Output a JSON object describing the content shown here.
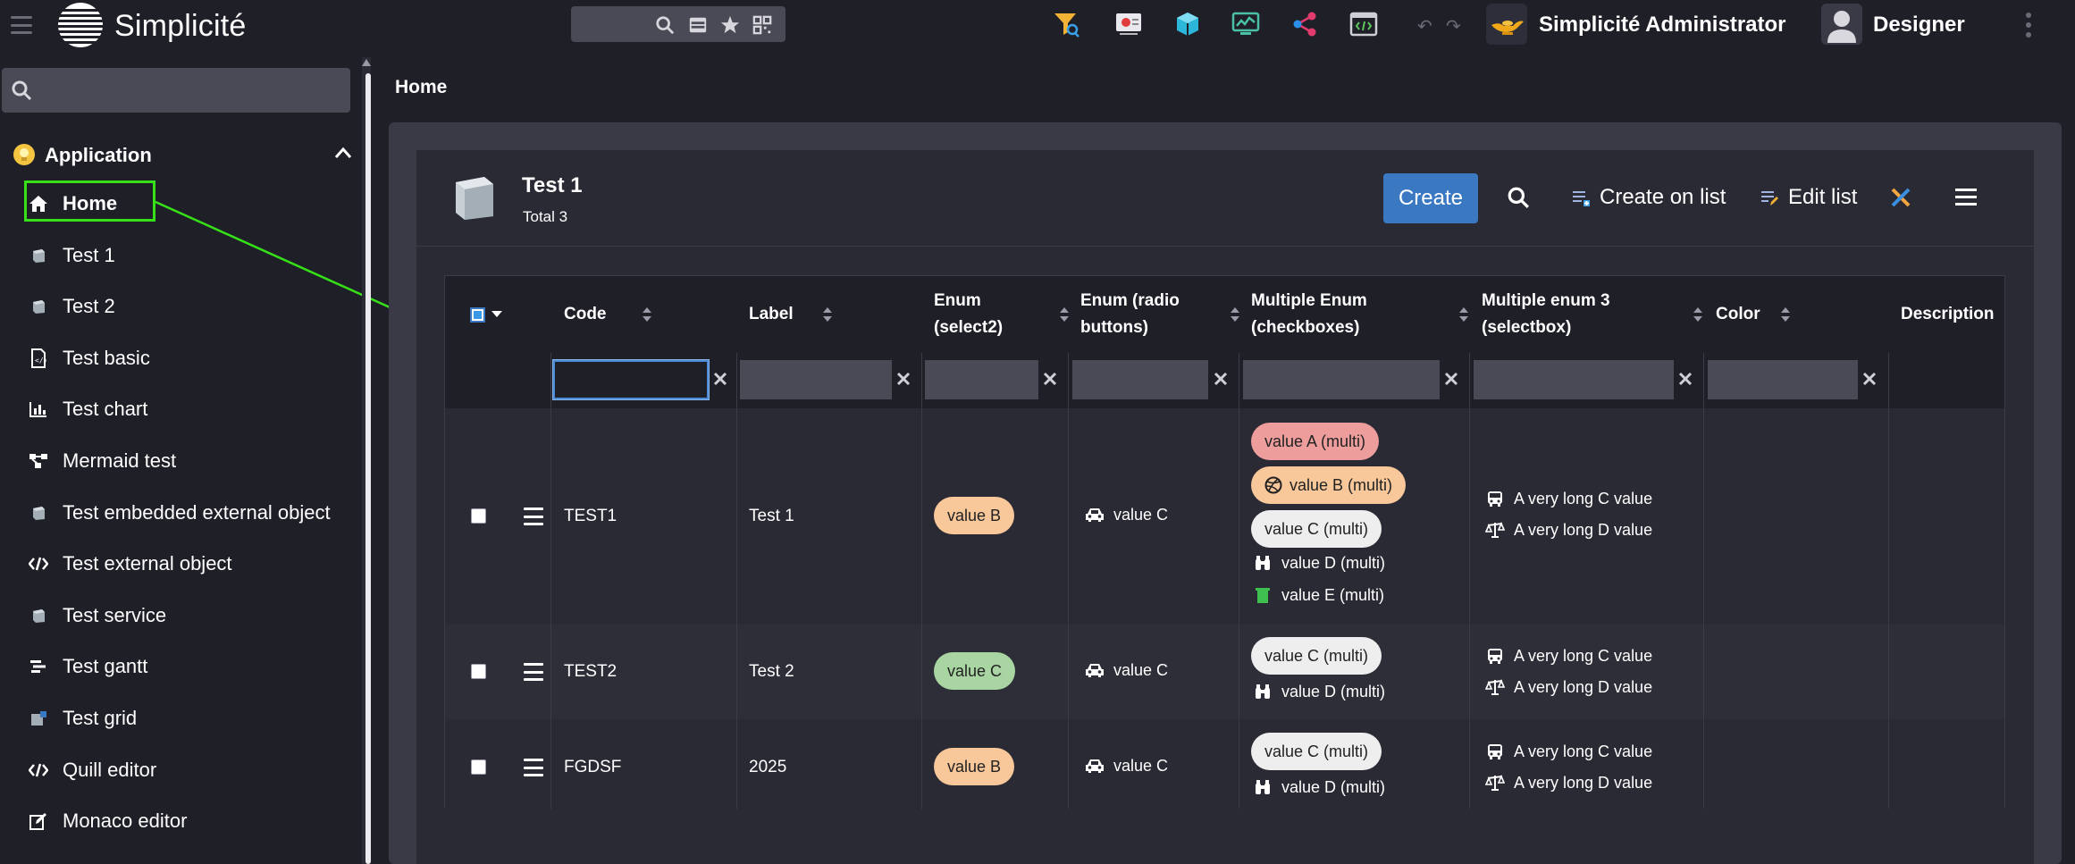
{
  "app": {
    "brand": "Simplicité"
  },
  "topbar": {
    "admin_name": "Simplicité Administrator",
    "user_name": "Designer"
  },
  "sidebar": {
    "search_placeholder": "",
    "group_label": "Application",
    "items": [
      {
        "label": "Home",
        "icon": "home-icon",
        "active": true
      },
      {
        "label": "Test 1",
        "icon": "object-icon"
      },
      {
        "label": "Test 2",
        "icon": "object-icon"
      },
      {
        "label": "Test basic",
        "icon": "document-icon"
      },
      {
        "label": "Test chart",
        "icon": "chart-icon"
      },
      {
        "label": "Mermaid test",
        "icon": "diagram-icon"
      },
      {
        "label": "Test embedded external object",
        "icon": "object-icon"
      },
      {
        "label": "Test external object",
        "icon": "code-icon"
      },
      {
        "label": "Test service",
        "icon": "object-icon"
      },
      {
        "label": "Test gantt",
        "icon": "gantt-icon"
      },
      {
        "label": "Test grid",
        "icon": "grid-icon"
      },
      {
        "label": "Quill editor",
        "icon": "code-icon"
      },
      {
        "label": "Monaco editor",
        "icon": "edit-icon"
      }
    ]
  },
  "breadcrumb": "Home",
  "object": {
    "title": "Test 1",
    "total": "Total 3",
    "create_label": "Create",
    "create_on_list_label": "Create on list",
    "edit_list_label": "Edit list"
  },
  "table": {
    "columns": [
      {
        "label": "Code"
      },
      {
        "label": "Label"
      },
      {
        "label": "Enum (select2)",
        "line1": "Enum",
        "line2": "(select2)"
      },
      {
        "label": "Enum (radio buttons)",
        "line1": "Enum (radio",
        "line2": "buttons)"
      },
      {
        "label": "Multiple Enum (checkboxes)",
        "line1": "Multiple Enum",
        "line2": "(checkboxes)"
      },
      {
        "label": "Multiple enum 3 (selectbox)",
        "line1": "Multiple enum 3",
        "line2": "(selectbox)"
      },
      {
        "label": "Color"
      },
      {
        "label": "Description"
      }
    ],
    "rows": [
      {
        "code": "TEST1",
        "label": "Test 1",
        "enum_select": "value B",
        "enum_radio": "value C",
        "multi_check": [
          "value A (multi)",
          "value B (multi)",
          "value C (multi)",
          "value D (multi)",
          "value E (multi)"
        ],
        "multi_select": [
          "A very long C value",
          "A very long D value"
        ]
      },
      {
        "code": "TEST2",
        "label": "Test 2",
        "enum_select": "value C",
        "enum_radio": "value C",
        "multi_check": [
          "value C (multi)",
          "value D (multi)"
        ],
        "multi_select": [
          "A very long C value",
          "A very long D value"
        ]
      },
      {
        "code": "FGDSF",
        "label": "2025",
        "enum_select": "value B",
        "enum_radio": "value C",
        "multi_check": [
          "value C (multi)",
          "value D (multi)"
        ],
        "multi_select": [
          "A very long C value",
          "A very long D value"
        ]
      }
    ]
  },
  "colors": {
    "accent_blue": "#3a78c2",
    "highlight_green": "#36e217",
    "pill_orange": "#f8c79a",
    "pill_red": "#ee9d9d",
    "pill_green": "#a8d5a2",
    "pill_light": "#eeeeee"
  }
}
